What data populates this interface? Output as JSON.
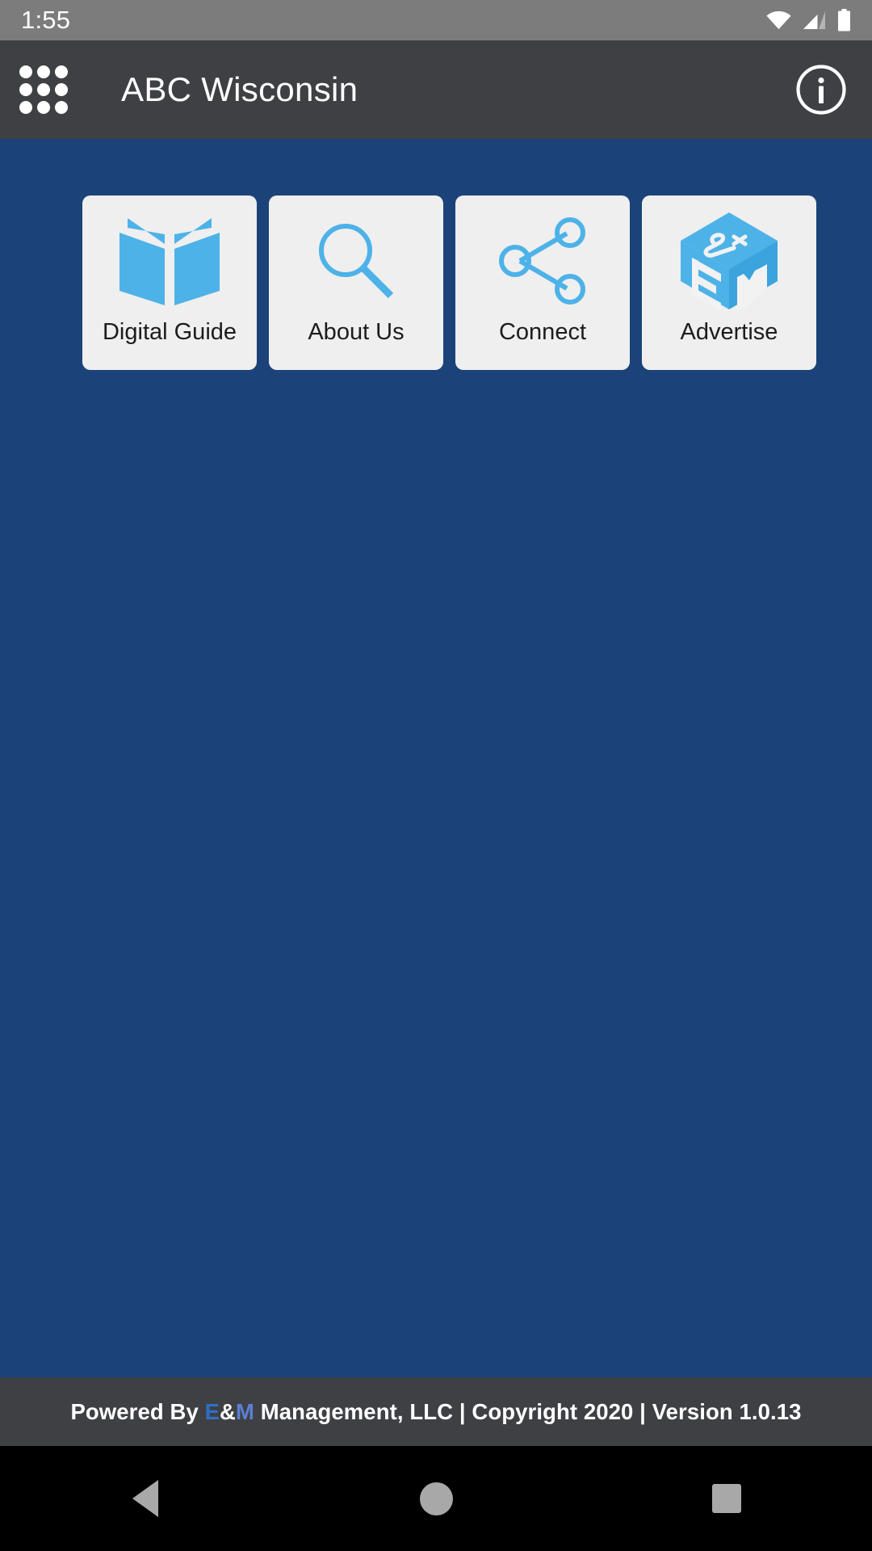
{
  "status_bar": {
    "time": "1:55",
    "icons": [
      "wifi-icon",
      "cellular-signal-icon",
      "battery-icon"
    ]
  },
  "app_bar": {
    "menu_icon": "apps-grid-icon",
    "title": "ABC Wisconsin",
    "info_icon": "info-icon"
  },
  "theme": {
    "background": "#1b4379",
    "app_bar": "#3f4044",
    "status_bar": "#7c7c7c",
    "tile_background": "#efefef",
    "icon_blue": "#4db2e8",
    "tile_label": "#1c1c1c",
    "footer_background": "#3f4044",
    "nav_background": "#000000"
  },
  "main": {
    "tiles": [
      {
        "label": "Digital Guide",
        "icon": "open-book-icon"
      },
      {
        "label": "About Us",
        "icon": "magnifier-icon"
      },
      {
        "label": "Connect",
        "icon": "share-nodes-icon"
      },
      {
        "label": "Advertise",
        "icon": "em-cube-logo-icon"
      }
    ]
  },
  "footer": {
    "prefix": "Powered By ",
    "brand_e": "E",
    "brand_amp": "&",
    "brand_m": "M",
    "suffix": " Management, LLC | Copyright 2020 | Version 1.0.13",
    "full_text": "Powered By E&M Management, LLC | Copyright 2020 | Version 1.0.13"
  },
  "nav_bar": {
    "back": "back-triangle-icon",
    "home": "home-circle-icon",
    "recents": "recents-square-icon"
  }
}
